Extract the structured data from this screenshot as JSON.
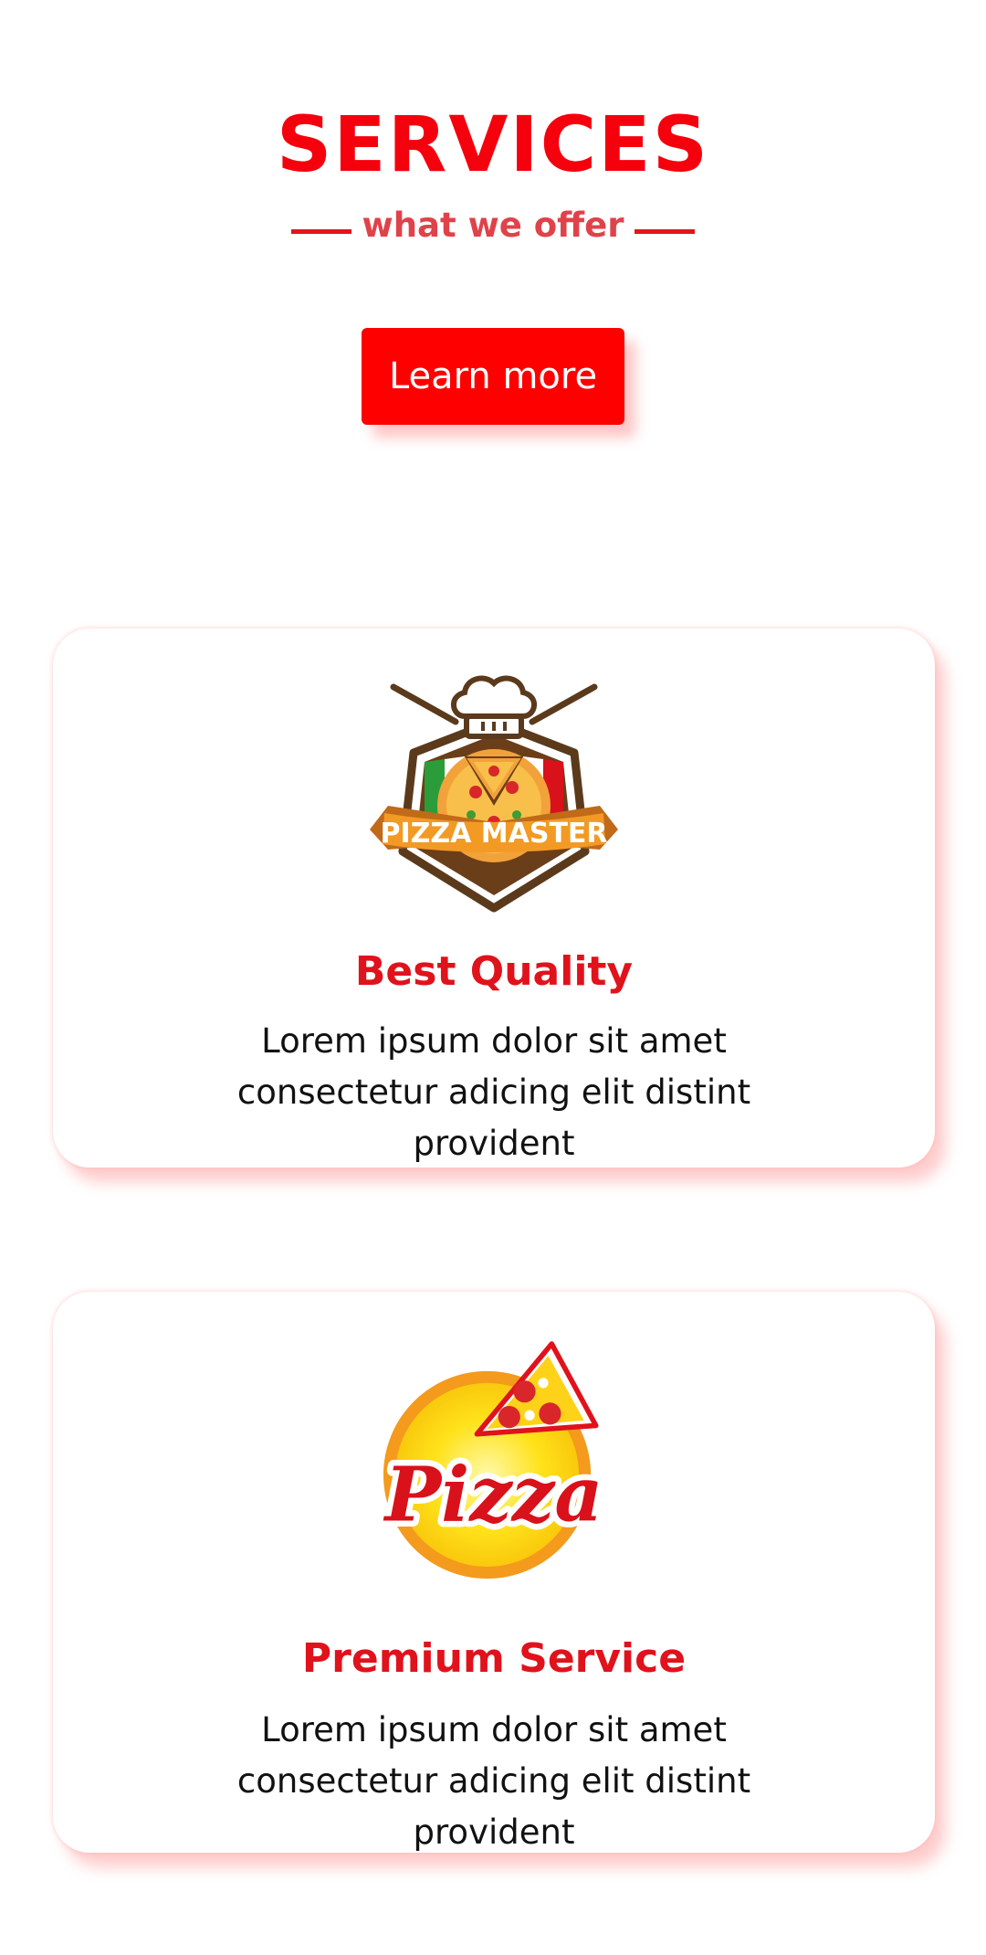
{
  "header": {
    "title": "SERVICES",
    "subtitle": "what we offer",
    "cta_label": "Learn more"
  },
  "colors": {
    "accent": "#f5000d",
    "subtitle": "#e0424a",
    "button": "#fe0000",
    "body_text": "#111111"
  },
  "cards": [
    {
      "logo_icon": "pizza-master-logo",
      "logo_text": "PIZZA MASTER",
      "title": "Best Quality",
      "text": "Lorem ipsum dolor sit amet consectetur adicing elit distint provident"
    },
    {
      "logo_icon": "pizza-logo",
      "logo_text": "Pizza",
      "title": "Premium Service",
      "text": "Lorem ipsum dolor sit amet consectetur adicing elit distint provident"
    }
  ]
}
